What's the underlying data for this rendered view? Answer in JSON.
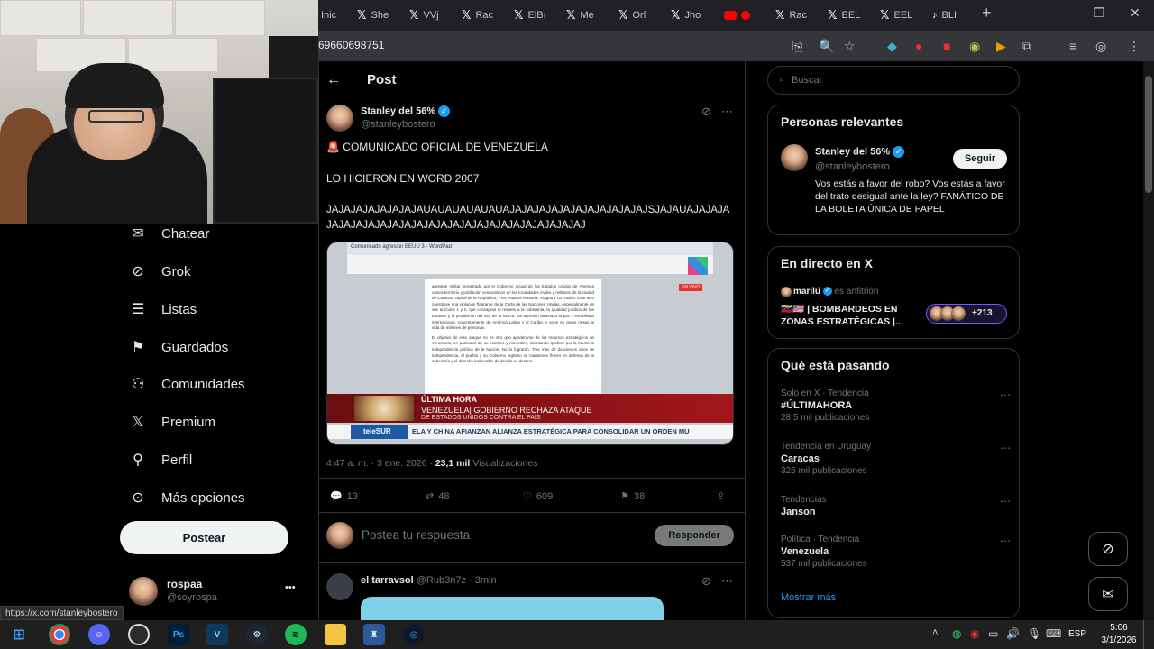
{
  "browser": {
    "tabs": [
      {
        "label": "Inic",
        "icon": "none"
      },
      {
        "label": "She",
        "icon": "x-icon"
      },
      {
        "label": "VVj",
        "icon": "x-icon"
      },
      {
        "label": "Rac",
        "icon": "x-icon"
      },
      {
        "label": "ElBı",
        "icon": "x-icon"
      },
      {
        "label": "Me",
        "icon": "x-icon"
      },
      {
        "label": "Orl",
        "icon": "x-icon"
      },
      {
        "label": "Jho",
        "icon": "x-icon"
      },
      {
        "label": "",
        "icon": "youtube-icon"
      },
      {
        "label": "Rac",
        "icon": "x-icon"
      },
      {
        "label": "EEL",
        "icon": "x-icon"
      },
      {
        "label": "EEL",
        "icon": "x-icon"
      },
      {
        "label": "BLI",
        "icon": "tiktok-icon"
      }
    ],
    "new_tab": "+",
    "url_fragment": "69660698751",
    "status_url": "https://x.com/stanleybostero"
  },
  "nav": {
    "items": [
      {
        "label": "Chatear",
        "icon": "mail-icon",
        "glyph": "✉"
      },
      {
        "label": "Grok",
        "icon": "grok-icon",
        "glyph": "⊘"
      },
      {
        "label": "Listas",
        "icon": "list-icon",
        "glyph": "☰"
      },
      {
        "label": "Guardados",
        "icon": "bookmark-icon",
        "glyph": "🔖"
      },
      {
        "label": "Comunidades",
        "icon": "communities-icon",
        "glyph": "👥"
      },
      {
        "label": "Premium",
        "icon": "x-logo-icon",
        "glyph": "𝕏"
      },
      {
        "label": "Perfil",
        "icon": "person-icon",
        "glyph": "👤"
      },
      {
        "label": "Más opciones",
        "icon": "more-icon",
        "glyph": "⋯"
      }
    ],
    "post_button": "Postear",
    "account": {
      "name": "rospaa",
      "handle": "@soyrospa",
      "menu": "•••"
    }
  },
  "post": {
    "header_title": "Post",
    "author_name": "Stanley del 56%",
    "author_handle": "@stanleybostero",
    "line1": "🚨 COMUNICADO OFICIAL DE VENEZUELA",
    "line2": "LO HICIERON EN WORD 2007",
    "line3": "JAJAJAJAJAJAJAJAUAUAUAUAUAUAJAJAJAJAJAJAJAJAJAJAJAJSJAJAUAJAJAJAJAJAJAJAJAJAJAJAJAJAJAJAJAJAJAJAJAJAJAJAJAJ",
    "timestamp": "4:47 a. m. · 3 ene. 2026 ·",
    "views_count": "23,1 mil",
    "views_label": "Visualizaciones",
    "stats": {
      "replies": "13",
      "reposts": "48",
      "likes": "609",
      "bookmarks": "38"
    },
    "reply_placeholder": "Postea tu respuesta",
    "reply_button": "Responder",
    "image": {
      "live_badge": "EN VIVO",
      "breaking_label": "ÚLTIMA HORA",
      "headline1": "VENEZUELA| GOBIERNO RECHAZA ATAQUE",
      "headline2": "DE ESTADOS UNIDOS CONTRA EL PAÍS",
      "ticker": "ELA Y CHINA AFIANZAN ALIANZA ESTRATÉGICA PARA CONSOLIDAR UN ORDEN MU",
      "channel": "teleSUR",
      "doc_title": "Comunicado agresion EEUU 3 - WordPad",
      "doc_text": "agresión militar perpetrada por el Gobierno actual de los Estados Unidos de América contra territorio y población venezolanos en las localidades civiles y militares de la ciudad de Caracas, capital de la República, y los estados Miranda, Aragua y La Guaira. Este acto constituye una violación flagrante de la Carta de las Naciones Unidas, especialmente de sus artículos 1 y 2, que consagran el respeto a la soberanía, la igualdad jurídica de los Estados y la prohibición del uso de la fuerza. Tal agresión amenaza la paz y estabilidad internacional, concretamente de América Latina y el Caribe, y pone en grave riesgo la vida de millones de personas.",
      "doc_text2": "El objetivo de este ataque no es otro que apoderarse de los recursos estratégicos de Venezuela, en particular de su petróleo y minerales, intentando quebrar por la fuerza la independencia política de la Nación. No lo lograrán. Tras más de doscientos años de independencia, el pueblo y su Gobierno legítimo se mantienen firmes en defensa de la soberanía y el derecho inalienable de decidir su destino."
    }
  },
  "reply": {
    "author_name": "el tarravsol",
    "author_handle": "@Rub3n7z",
    "time": "· 3min"
  },
  "sidebar": {
    "search_placeholder": "Buscar",
    "relevant": {
      "title": "Personas relevantes",
      "name": "Stanley del 56%",
      "handle": "@stanleybostero",
      "follow_button": "Seguir",
      "bio": "Vos estás a favor del robo? Vos estás a favor del trato desigual ante la ley? FANÁTICO DE LA BOLETA ÚNICA DE PAPEL"
    },
    "live": {
      "title": "En directo en X",
      "host": "marilú",
      "host_label": "es anfitrión",
      "space_title": "🇻🇪🇺🇸 | BOMBARDEOS EN ZONAS ESTRATÉGICAS |...",
      "listeners": "+213"
    },
    "trends": {
      "title": "Qué está pasando",
      "items": [
        {
          "category": "Solo en X · Tendencia",
          "name": "#ÚLTIMAHORA",
          "count": "28,5 mil publicaciones"
        },
        {
          "category": "Tendencia en Uruguay",
          "name": "Caracas",
          "count": "325 mil publicaciones"
        },
        {
          "category": "Tendencias",
          "name": "Janson",
          "count": ""
        },
        {
          "category": "Política · Tendencia",
          "name": "Venezuela",
          "count": "537 mil publicaciones"
        }
      ],
      "show_more": "Mostrar más"
    }
  },
  "taskbar": {
    "language": "ESP",
    "time": "5:06",
    "date": "3/1/2026",
    "apps": [
      "start-icon",
      "chrome-icon",
      "discord-icon",
      "obs-icon",
      "photoshop-icon",
      "vegas-icon",
      "steam-icon",
      "spotify-icon",
      "explorer-icon",
      "bloons-icon",
      "battlenet-icon"
    ]
  },
  "colors": {
    "accent": "#1d9bf0",
    "background": "#000000",
    "border": "#2f3336",
    "muted": "#71767b"
  }
}
